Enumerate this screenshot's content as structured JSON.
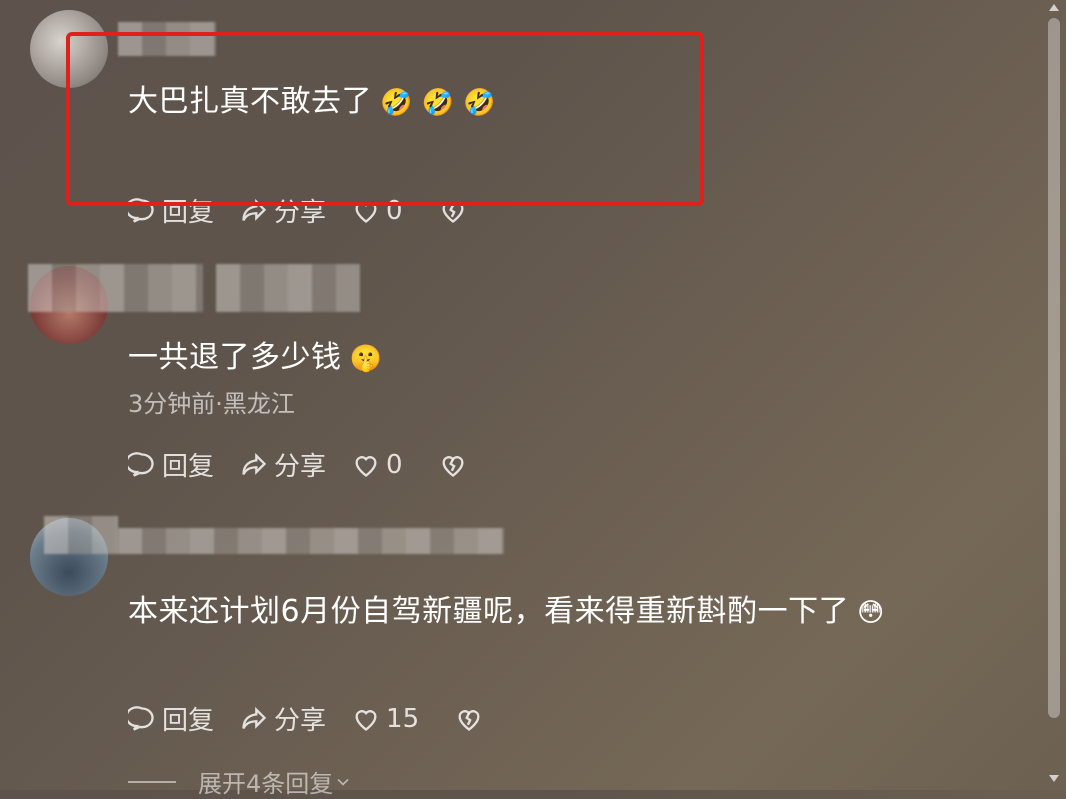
{
  "comments": [
    {
      "text": "大巴扎真不敢去了",
      "emoji": "🤣 🤣 🤣",
      "meta": "",
      "reply_label": "回复",
      "share_label": "分享",
      "like_count": "0"
    },
    {
      "text": "一共退了多少钱",
      "emoji": "🤫",
      "meta": "3分钟前·黑龙江",
      "reply_label": "回复",
      "share_label": "分享",
      "like_count": "0"
    },
    {
      "text": "本来还计划6月份自驾新疆呢，看来得重新斟酌一下了",
      "emoji": "😳",
      "meta": "",
      "reply_label": "回复",
      "share_label": "分享",
      "like_count": "15"
    }
  ],
  "expand_replies_label": "展开4条回复",
  "colors": {
    "highlight": "#e0201a"
  }
}
